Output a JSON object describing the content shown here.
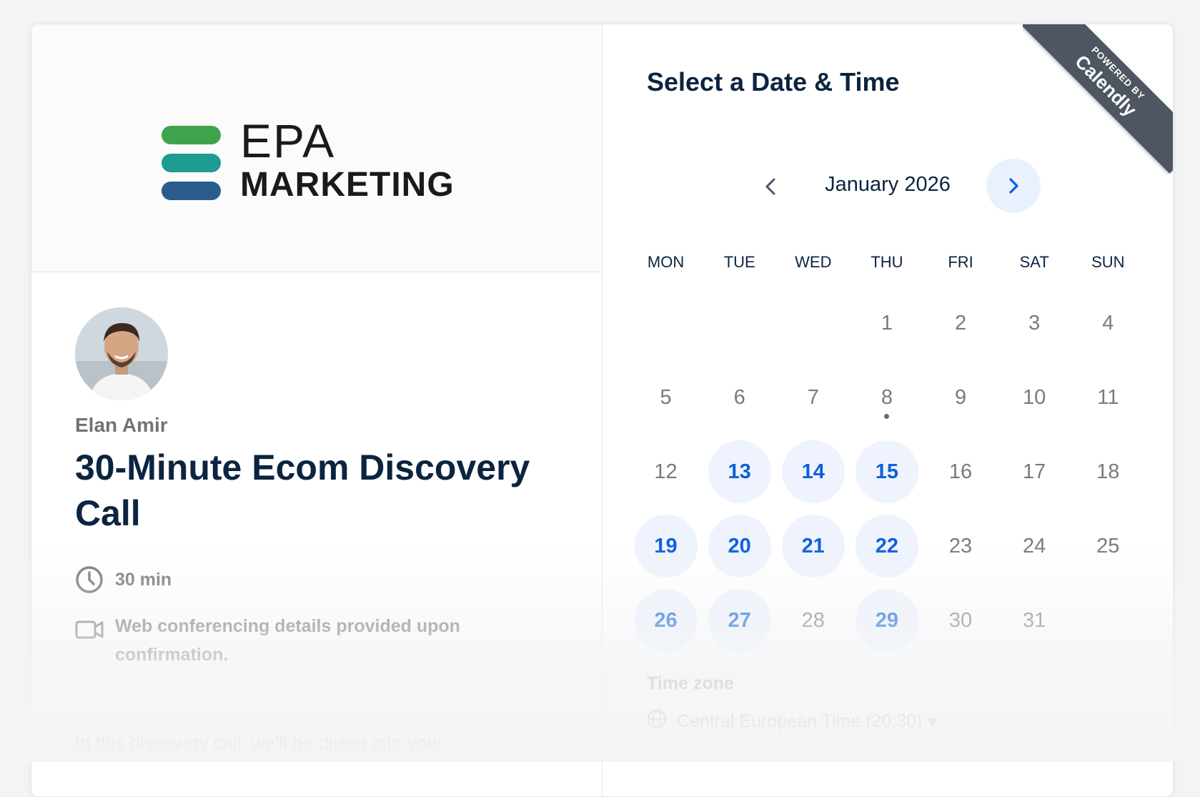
{
  "colors": {
    "accent": "#0d5fdc",
    "available_bg": "#eef3fd",
    "ribbon": "#4d5661",
    "text_dark": "#0b2440",
    "text_muted": "#737373",
    "logo_green": "#3fa34d",
    "logo_teal": "#1d9c92",
    "logo_blue": "#2a5d8b"
  },
  "brand": {
    "logo_line1": "EPA",
    "logo_line2": "MARKETING"
  },
  "ribbon": {
    "line1": "POWERED BY",
    "line2": "Calendly"
  },
  "event": {
    "organizer": "Elan Amir",
    "title": "30-Minute Ecom Discovery Call",
    "duration": "30 min",
    "duration_icon": "clock-icon",
    "location": "Web conferencing details provided upon confirmation.",
    "location_icon": "video-camera-icon",
    "description_start": "In this discovery call, we'll be diving into your"
  },
  "calendar": {
    "heading": "Select a Date & Time",
    "month_label": "January 2026",
    "prev_icon": "chevron-left-icon",
    "next_icon": "chevron-right-icon",
    "weekdays": [
      "MON",
      "TUE",
      "WED",
      "THU",
      "FRI",
      "SAT",
      "SUN"
    ],
    "leading_blanks": 3,
    "days": [
      {
        "n": "1",
        "avail": false
      },
      {
        "n": "2",
        "avail": false
      },
      {
        "n": "3",
        "avail": false
      },
      {
        "n": "4",
        "avail": false
      },
      {
        "n": "5",
        "avail": false
      },
      {
        "n": "6",
        "avail": false
      },
      {
        "n": "7",
        "avail": false
      },
      {
        "n": "8",
        "avail": false,
        "today": true
      },
      {
        "n": "9",
        "avail": false
      },
      {
        "n": "10",
        "avail": false
      },
      {
        "n": "11",
        "avail": false
      },
      {
        "n": "12",
        "avail": false
      },
      {
        "n": "13",
        "avail": true
      },
      {
        "n": "14",
        "avail": true
      },
      {
        "n": "15",
        "avail": true
      },
      {
        "n": "16",
        "avail": false
      },
      {
        "n": "17",
        "avail": false
      },
      {
        "n": "18",
        "avail": false
      },
      {
        "n": "19",
        "avail": true
      },
      {
        "n": "20",
        "avail": true
      },
      {
        "n": "21",
        "avail": true
      },
      {
        "n": "22",
        "avail": true
      },
      {
        "n": "23",
        "avail": false
      },
      {
        "n": "24",
        "avail": false
      },
      {
        "n": "25",
        "avail": false
      },
      {
        "n": "26",
        "avail": true
      },
      {
        "n": "27",
        "avail": true
      },
      {
        "n": "28",
        "avail": false
      },
      {
        "n": "29",
        "avail": true
      },
      {
        "n": "30",
        "avail": false
      },
      {
        "n": "31",
        "avail": false
      }
    ],
    "timezone_label": "Time zone",
    "timezone_value": "Central European Time (20:30)",
    "timezone_icon": "globe-icon"
  }
}
